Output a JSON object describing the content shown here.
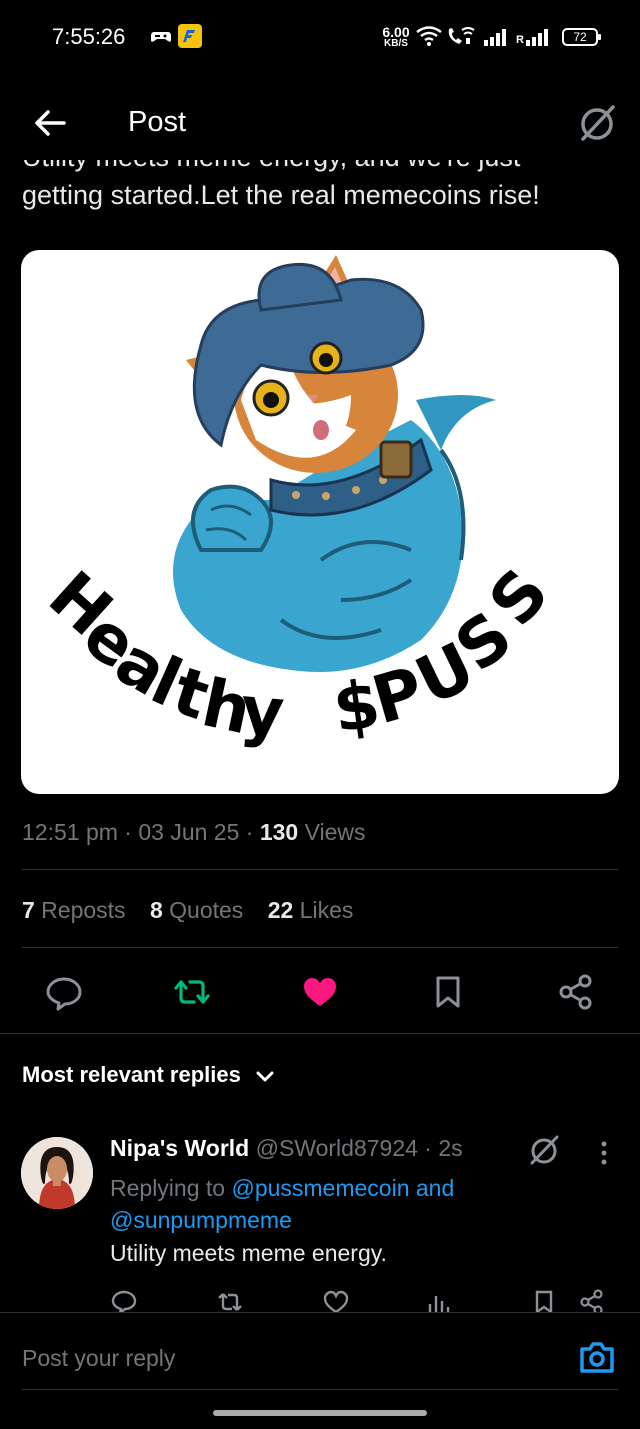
{
  "status_bar": {
    "time": "7:55:26",
    "speed_value": "6.00",
    "speed_unit": "KB/S",
    "roaming": "R",
    "battery": "72"
  },
  "header": {
    "title": "Post"
  },
  "tweet": {
    "text_partial_top": "Utility meets meme energy, and we're just",
    "text_visible": "getting started.Let the real memecoins rise!",
    "image": {
      "caption_art": "Healthy $PUSS"
    },
    "time": "12:51 pm",
    "sep1": " · ",
    "date": "03 Jun 25",
    "sep2": " · ",
    "views_count": "130",
    "views_label": " Views"
  },
  "stats": {
    "reposts_count": "7",
    "reposts_label": " Reposts",
    "quotes_count": "8",
    "quotes_label": " Quotes",
    "likes_count": "22",
    "likes_label": " Likes"
  },
  "actions": {
    "reply_icon": "reply-icon",
    "repost_icon": "repost-icon",
    "like_icon": "heart-icon",
    "bookmark_icon": "bookmark-icon",
    "share_icon": "share-icon",
    "repost_color": "#00ba7c",
    "like_color": "#f91880"
  },
  "replies": {
    "heading": "Most relevant replies",
    "items": [
      {
        "name": "Nipa's World",
        "handle": "@SWorld87924",
        "sep": " · ",
        "time": "2s",
        "replying_prefix": "Replying to ",
        "mention1": "@pussmemecoin and",
        "mention2": "@sunpumpmeme",
        "text": "Utility meets meme energy."
      }
    ]
  },
  "compose": {
    "placeholder": "Post your reply"
  },
  "colors": {
    "background": "#000000",
    "text": "#e7e9ea",
    "muted": "#71767b",
    "accent": "#1d9bf0",
    "divider": "#2f3336"
  }
}
